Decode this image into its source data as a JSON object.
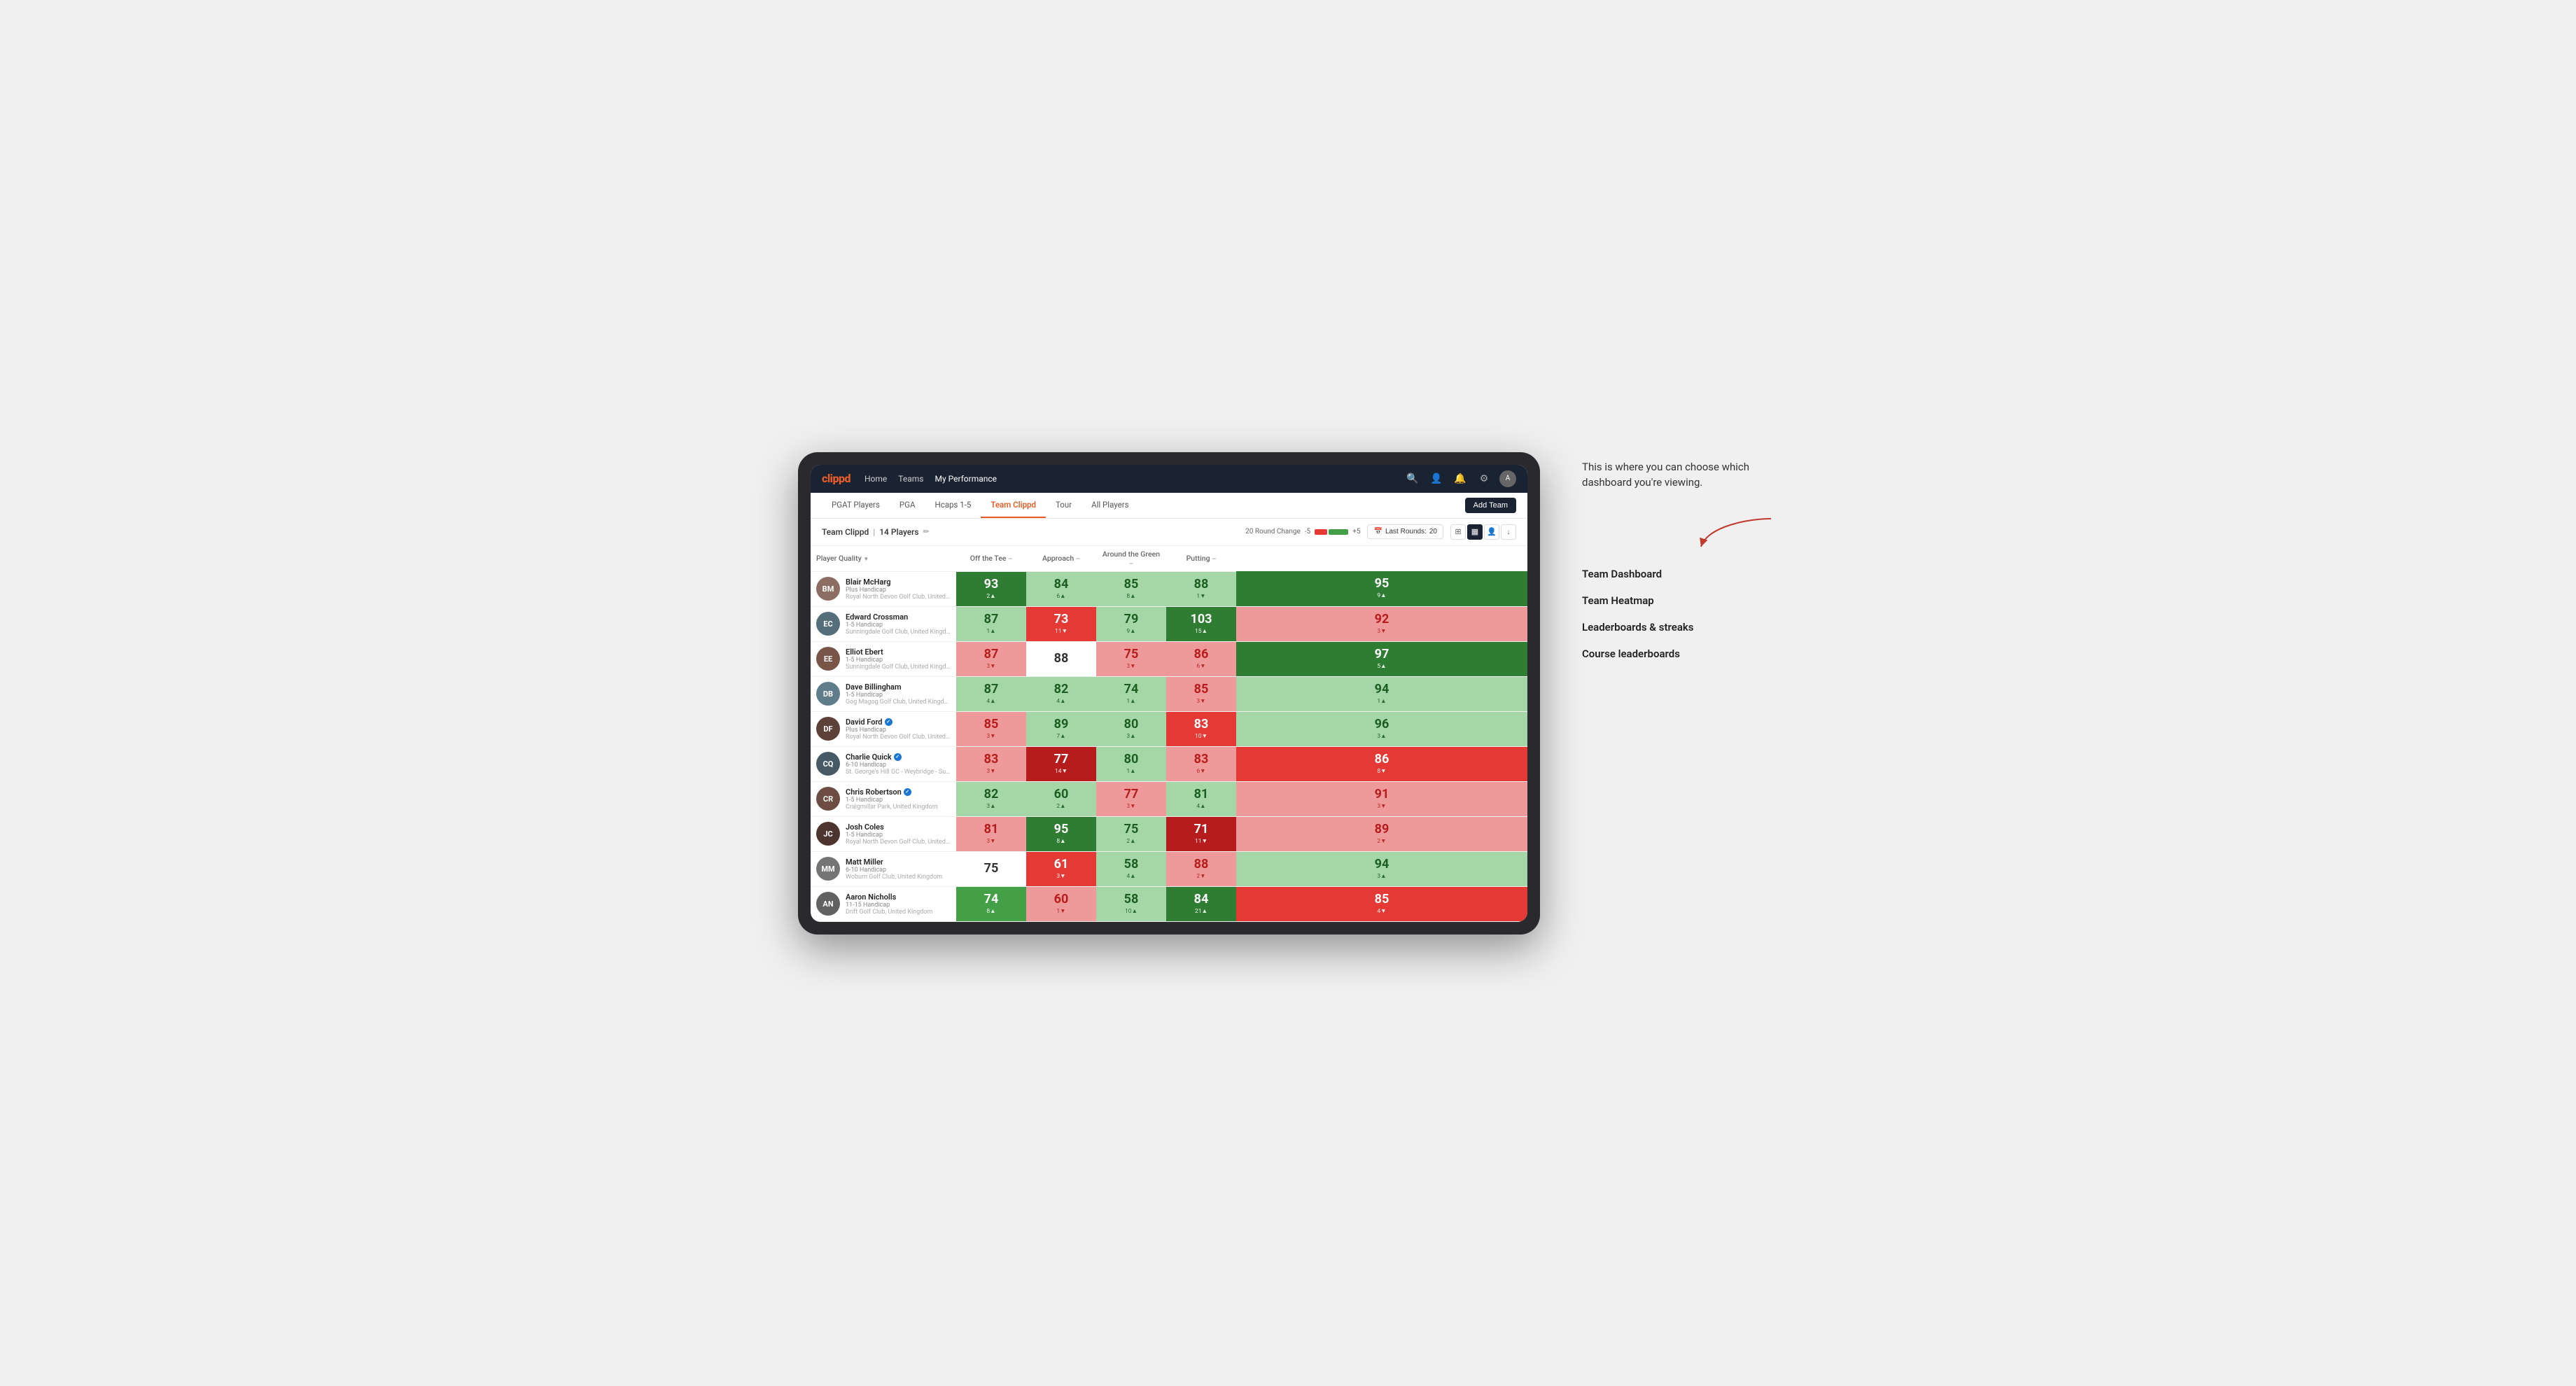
{
  "annotation": {
    "intro": "This is where you can choose which dashboard you're viewing.",
    "items": [
      "Team Dashboard",
      "Team Heatmap",
      "Leaderboards & streaks",
      "Course leaderboards"
    ]
  },
  "nav": {
    "logo": "clippd",
    "links": [
      "Home",
      "Teams",
      "My Performance"
    ],
    "active_link": "My Performance"
  },
  "sub_tabs": {
    "tabs": [
      "PGAT Players",
      "PGA",
      "Hcaps 1-5",
      "Team Clippd",
      "Tour",
      "All Players"
    ],
    "active_tab": "Team Clippd",
    "add_button": "Add Team"
  },
  "team_header": {
    "title": "Team Clippd",
    "player_count": "14 Players",
    "round_change_label": "20 Round Change",
    "change_negative": "-5",
    "change_positive": "+5",
    "last_rounds_label": "Last Rounds:",
    "last_rounds_value": "20"
  },
  "table": {
    "columns": {
      "player": "Player Quality",
      "off_tee": "Off the Tee",
      "approach": "Approach",
      "around_green": "Around the Green",
      "putting": "Putting"
    },
    "players": [
      {
        "name": "Blair McHarg",
        "handicap": "Plus Handicap",
        "club": "Royal North Devon Golf Club, United Kingdom",
        "avatar_class": "av-1",
        "initials": "BM",
        "quality": {
          "value": "93",
          "change": "2",
          "dir": "up",
          "bg": "bg-dark-green"
        },
        "off_tee": {
          "value": "84",
          "change": "6",
          "dir": "up",
          "bg": "bg-light-green"
        },
        "approach": {
          "value": "85",
          "change": "8",
          "dir": "up",
          "bg": "bg-light-green"
        },
        "around_green": {
          "value": "88",
          "change": "1",
          "dir": "down",
          "bg": "bg-light-green"
        },
        "putting": {
          "value": "95",
          "change": "9",
          "dir": "up",
          "bg": "bg-dark-green"
        }
      },
      {
        "name": "Edward Crossman",
        "handicap": "1-5 Handicap",
        "club": "Sunningdale Golf Club, United Kingdom",
        "avatar_class": "av-2",
        "initials": "EC",
        "quality": {
          "value": "87",
          "change": "1",
          "dir": "up",
          "bg": "bg-light-green"
        },
        "off_tee": {
          "value": "73",
          "change": "11",
          "dir": "down",
          "bg": "bg-red"
        },
        "approach": {
          "value": "79",
          "change": "9",
          "dir": "up",
          "bg": "bg-light-green"
        },
        "around_green": {
          "value": "103",
          "change": "15",
          "dir": "up",
          "bg": "bg-dark-green"
        },
        "putting": {
          "value": "92",
          "change": "3",
          "dir": "down",
          "bg": "bg-light-red"
        }
      },
      {
        "name": "Elliot Ebert",
        "handicap": "1-5 Handicap",
        "club": "Sunningdale Golf Club, United Kingdom",
        "avatar_class": "av-3",
        "initials": "EE",
        "quality": {
          "value": "87",
          "change": "3",
          "dir": "down",
          "bg": "bg-light-red"
        },
        "off_tee": {
          "value": "88",
          "change": "",
          "dir": "none",
          "bg": "bg-white"
        },
        "approach": {
          "value": "75",
          "change": "3",
          "dir": "down",
          "bg": "bg-light-red"
        },
        "around_green": {
          "value": "86",
          "change": "6",
          "dir": "down",
          "bg": "bg-light-red"
        },
        "putting": {
          "value": "97",
          "change": "5",
          "dir": "up",
          "bg": "bg-dark-green"
        }
      },
      {
        "name": "Dave Billingham",
        "handicap": "1-5 Handicap",
        "club": "Gog Magog Golf Club, United Kingdom",
        "avatar_class": "av-4",
        "initials": "DB",
        "quality": {
          "value": "87",
          "change": "4",
          "dir": "up",
          "bg": "bg-light-green"
        },
        "off_tee": {
          "value": "82",
          "change": "4",
          "dir": "up",
          "bg": "bg-light-green"
        },
        "approach": {
          "value": "74",
          "change": "1",
          "dir": "up",
          "bg": "bg-light-green"
        },
        "around_green": {
          "value": "85",
          "change": "3",
          "dir": "down",
          "bg": "bg-light-red"
        },
        "putting": {
          "value": "94",
          "change": "1",
          "dir": "up",
          "bg": "bg-light-green"
        }
      },
      {
        "name": "David Ford",
        "handicap": "Plus Handicap",
        "club": "Royal North Devon Golf Club, United Kingdom",
        "avatar_class": "av-5",
        "initials": "DF",
        "verified": true,
        "quality": {
          "value": "85",
          "change": "3",
          "dir": "down",
          "bg": "bg-light-red"
        },
        "off_tee": {
          "value": "89",
          "change": "7",
          "dir": "up",
          "bg": "bg-light-green"
        },
        "approach": {
          "value": "80",
          "change": "3",
          "dir": "up",
          "bg": "bg-light-green"
        },
        "around_green": {
          "value": "83",
          "change": "10",
          "dir": "down",
          "bg": "bg-red"
        },
        "putting": {
          "value": "96",
          "change": "3",
          "dir": "up",
          "bg": "bg-light-green"
        }
      },
      {
        "name": "Charlie Quick",
        "handicap": "6-10 Handicap",
        "club": "St. George's Hill GC - Weybridge - Surrey, Uni...",
        "avatar_class": "av-6",
        "initials": "CQ",
        "verified": true,
        "quality": {
          "value": "83",
          "change": "3",
          "dir": "down",
          "bg": "bg-light-red"
        },
        "off_tee": {
          "value": "77",
          "change": "14",
          "dir": "down",
          "bg": "bg-dark-red"
        },
        "approach": {
          "value": "80",
          "change": "1",
          "dir": "up",
          "bg": "bg-light-green"
        },
        "around_green": {
          "value": "83",
          "change": "6",
          "dir": "down",
          "bg": "bg-light-red"
        },
        "putting": {
          "value": "86",
          "change": "8",
          "dir": "down",
          "bg": "bg-red"
        }
      },
      {
        "name": "Chris Robertson",
        "handicap": "1-5 Handicap",
        "club": "Craigmillar Park, United Kingdom",
        "avatar_class": "av-7",
        "initials": "CR",
        "verified": true,
        "quality": {
          "value": "82",
          "change": "3",
          "dir": "up",
          "bg": "bg-light-green"
        },
        "off_tee": {
          "value": "60",
          "change": "2",
          "dir": "up",
          "bg": "bg-light-green"
        },
        "approach": {
          "value": "77",
          "change": "3",
          "dir": "down",
          "bg": "bg-light-red"
        },
        "around_green": {
          "value": "81",
          "change": "4",
          "dir": "up",
          "bg": "bg-light-green"
        },
        "putting": {
          "value": "91",
          "change": "3",
          "dir": "down",
          "bg": "bg-light-red"
        }
      },
      {
        "name": "Josh Coles",
        "handicap": "1-5 Handicap",
        "club": "Royal North Devon Golf Club, United Kingdom",
        "avatar_class": "av-8",
        "initials": "JC",
        "quality": {
          "value": "81",
          "change": "3",
          "dir": "down",
          "bg": "bg-light-red"
        },
        "off_tee": {
          "value": "95",
          "change": "8",
          "dir": "up",
          "bg": "bg-dark-green"
        },
        "approach": {
          "value": "75",
          "change": "2",
          "dir": "up",
          "bg": "bg-light-green"
        },
        "around_green": {
          "value": "71",
          "change": "11",
          "dir": "down",
          "bg": "bg-dark-red"
        },
        "putting": {
          "value": "89",
          "change": "2",
          "dir": "down",
          "bg": "bg-light-red"
        }
      },
      {
        "name": "Matt Miller",
        "handicap": "6-10 Handicap",
        "club": "Woburn Golf Club, United Kingdom",
        "avatar_class": "av-9",
        "initials": "MM",
        "quality": {
          "value": "75",
          "change": "",
          "dir": "none",
          "bg": "bg-white"
        },
        "off_tee": {
          "value": "61",
          "change": "3",
          "dir": "down",
          "bg": "bg-red"
        },
        "approach": {
          "value": "58",
          "change": "4",
          "dir": "up",
          "bg": "bg-light-green"
        },
        "around_green": {
          "value": "88",
          "change": "2",
          "dir": "down",
          "bg": "bg-light-red"
        },
        "putting": {
          "value": "94",
          "change": "3",
          "dir": "up",
          "bg": "bg-light-green"
        }
      },
      {
        "name": "Aaron Nicholls",
        "handicap": "11-15 Handicap",
        "club": "Drift Golf Club, United Kingdom",
        "avatar_class": "av-10",
        "initials": "AN",
        "quality": {
          "value": "74",
          "change": "8",
          "dir": "up",
          "bg": "bg-green"
        },
        "off_tee": {
          "value": "60",
          "change": "1",
          "dir": "down",
          "bg": "bg-light-red"
        },
        "approach": {
          "value": "58",
          "change": "10",
          "dir": "up",
          "bg": "bg-light-green"
        },
        "around_green": {
          "value": "84",
          "change": "21",
          "dir": "up",
          "bg": "bg-dark-green"
        },
        "putting": {
          "value": "85",
          "change": "4",
          "dir": "down",
          "bg": "bg-red"
        }
      }
    ]
  }
}
